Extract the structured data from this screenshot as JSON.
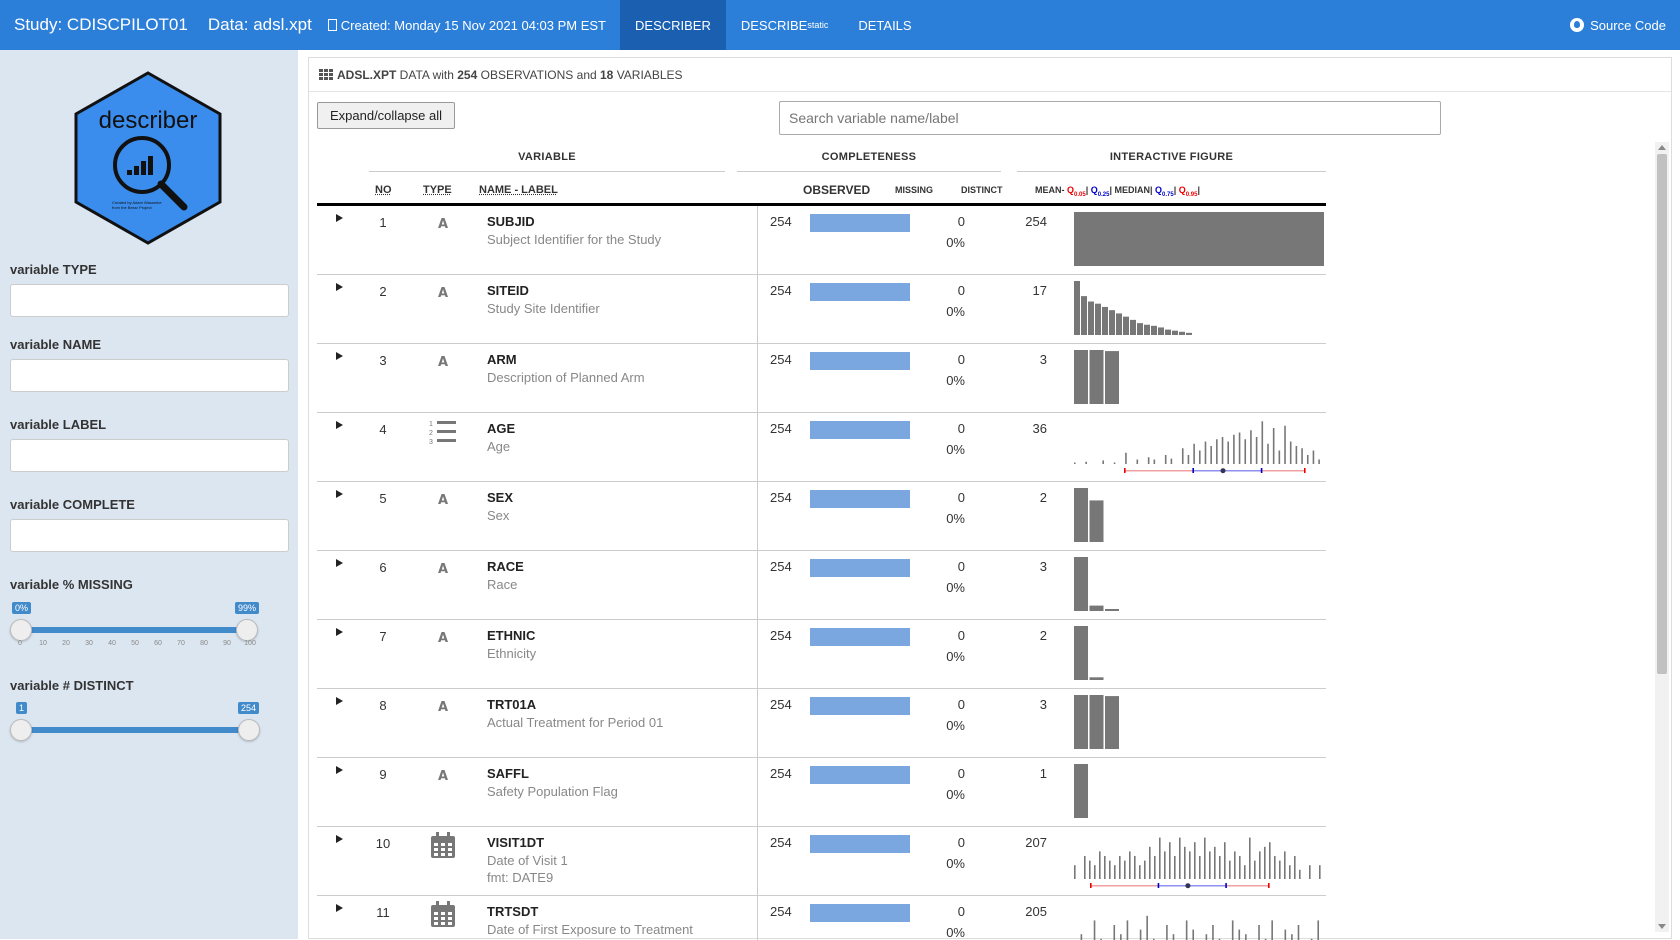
{
  "nav": {
    "study": "Study: CDISCPILOT01",
    "data": "Data: adsl.xpt",
    "created": "Created: Monday 15 Nov 2021 04:03 PM EST",
    "tabs": [
      {
        "label": "DESCRIBER",
        "sub": "",
        "active": true
      },
      {
        "label": "DESCRIBE",
        "sub": "static",
        "active": false
      },
      {
        "label": "DETAILS",
        "sub": "",
        "active": false
      }
    ],
    "source": "Source Code"
  },
  "sidebar": {
    "logo_text": "describer",
    "logo_credit_line1": "Created by Adam Wasserke",
    "logo_credit_line2": "from the Bessr Project",
    "filters": [
      {
        "label": "variable TYPE"
      },
      {
        "label": "variable NAME"
      },
      {
        "label": "variable LABEL"
      },
      {
        "label": "variable COMPLETE"
      }
    ],
    "missing_slider": {
      "label": "variable % MISSING",
      "low": "0%",
      "high": "99%",
      "ticks": [
        "0",
        "10",
        "20",
        "30",
        "40",
        "50",
        "60",
        "70",
        "80",
        "90",
        "100"
      ]
    },
    "distinct_slider": {
      "label": "variable # DISTINCT",
      "low": "1",
      "high": "254"
    }
  },
  "main": {
    "header_file": "ADSL.XPT",
    "header_mid1": " DATA with ",
    "header_obs": "254",
    "header_mid2": " OBSERVATIONS and ",
    "header_vars": "18",
    "header_end": " VARIABLES",
    "expand_label": "Expand/collapse all",
    "search_placeholder": "Search variable name/label",
    "groups": {
      "variable": "VARIABLE",
      "completeness": "COMPLETENESS",
      "figure": "INTERACTIVE FIGURE"
    },
    "columns": {
      "no": "NO",
      "type": "TYPE",
      "name": "NAME - LABEL",
      "observed": "OBSERVED",
      "missing": "MISSING",
      "distinct": "DISTINCT"
    },
    "legend": {
      "mean": "MEAN",
      "median": "MEDIAN",
      "q005": "Q",
      "q005s": "0.05",
      "q025": "Q",
      "q025s": "0.25",
      "q075": "Q",
      "q075s": "0.75",
      "q095": "Q",
      "q095s": "0.95"
    },
    "rows": [
      {
        "no": "1",
        "type": "A",
        "name": "SUBJID",
        "label": "Subject Identifier for the Study",
        "fmt": "",
        "observed": "254",
        "missing": "0",
        "missing_pct": "0%",
        "distinct": "254",
        "fig": "full",
        "bars": []
      },
      {
        "no": "2",
        "type": "A",
        "name": "SITEID",
        "label": "Study Site Identifier",
        "fmt": "",
        "observed": "254",
        "missing": "0",
        "missing_pct": "0%",
        "distinct": "17",
        "fig": "bars",
        "bars": [
          1.0,
          0.72,
          0.62,
          0.58,
          0.52,
          0.46,
          0.4,
          0.34,
          0.28,
          0.22,
          0.19,
          0.17,
          0.14,
          0.1,
          0.08,
          0.06,
          0.04
        ]
      },
      {
        "no": "3",
        "type": "A",
        "name": "ARM",
        "label": "Description of Planned Arm",
        "fmt": "",
        "observed": "254",
        "missing": "0",
        "missing_pct": "0%",
        "distinct": "3",
        "fig": "bars",
        "bars": [
          1.0,
          1.0,
          0.98
        ]
      },
      {
        "no": "4",
        "type": "num",
        "name": "AGE",
        "label": "Age",
        "fmt": "",
        "observed": "254",
        "missing": "0",
        "missing_pct": "0%",
        "distinct": "36",
        "fig": "spikes",
        "bars": [
          0.03,
          0,
          0.05,
          0,
          0,
          0.08,
          0,
          0.02,
          0,
          0.25,
          0,
          0.1,
          0,
          0.15,
          0.1,
          0,
          0.2,
          0.12,
          0,
          0.35,
          0.2,
          0.45,
          0.3,
          0.5,
          0.4,
          0.55,
          0.6,
          0.5,
          0.65,
          0.7,
          0.55,
          0.75,
          0.6,
          0.95,
          0.45,
          0.8,
          0.3,
          0.85,
          0.5,
          0.4,
          0.35,
          0.2,
          0.3,
          0.1
        ]
      },
      {
        "no": "5",
        "type": "A",
        "name": "SEX",
        "label": "Sex",
        "fmt": "",
        "observed": "254",
        "missing": "0",
        "missing_pct": "0%",
        "distinct": "2",
        "fig": "bars",
        "bars": [
          1.0,
          0.77
        ]
      },
      {
        "no": "6",
        "type": "A",
        "name": "RACE",
        "label": "Race",
        "fmt": "",
        "observed": "254",
        "missing": "0",
        "missing_pct": "0%",
        "distinct": "3",
        "fig": "bars",
        "bars": [
          1.0,
          0.1,
          0.02
        ]
      },
      {
        "no": "7",
        "type": "A",
        "name": "ETHNIC",
        "label": "Ethnicity",
        "fmt": "",
        "observed": "254",
        "missing": "0",
        "missing_pct": "0%",
        "distinct": "2",
        "fig": "bars",
        "bars": [
          1.0,
          0.05
        ]
      },
      {
        "no": "8",
        "type": "A",
        "name": "TRT01A",
        "label": "Actual Treatment for Period 01",
        "fmt": "",
        "observed": "254",
        "missing": "0",
        "missing_pct": "0%",
        "distinct": "3",
        "fig": "bars",
        "bars": [
          1.0,
          1.0,
          0.98
        ]
      },
      {
        "no": "9",
        "type": "A",
        "name": "SAFFL",
        "label": "Safety Population Flag",
        "fmt": "",
        "observed": "254",
        "missing": "0",
        "missing_pct": "0%",
        "distinct": "1",
        "fig": "bars",
        "bars": [
          1.0
        ]
      },
      {
        "no": "10",
        "type": "date",
        "name": "VISIT1DT",
        "label": "Date of Visit 1",
        "fmt": "fmt: DATE9",
        "observed": "254",
        "missing": "0",
        "missing_pct": "0%",
        "distinct": "207",
        "fig": "spikes2",
        "bars": [
          0.3,
          0,
          0.5,
          0.4,
          0.3,
          0.6,
          0.5,
          0.4,
          0.3,
          0.5,
          0.4,
          0.6,
          0.5,
          0.3,
          0.4,
          0.7,
          0.5,
          0.9,
          0.6,
          0.8,
          0.5,
          0.9,
          0.7,
          0.6,
          0.8,
          0.5,
          0.9,
          0.6,
          0.7,
          0.5,
          0.8,
          0.4,
          0.6,
          0.5,
          0.3,
          0.9,
          0.4,
          0.6,
          0.7,
          0.8,
          0.5,
          0.4,
          0.6,
          0.3,
          0.5,
          0.2,
          0,
          0.3,
          0,
          0.3
        ]
      },
      {
        "no": "11",
        "type": "date",
        "name": "TRTSDT",
        "label": "Date of First Exposure to Treatment",
        "fmt": "",
        "observed": "254",
        "missing": "0",
        "missing_pct": "0%",
        "distinct": "205",
        "fig": "spikes2",
        "bars": [
          0,
          0.3,
          0,
          0.6,
          0.2,
          0,
          0.5,
          0.3,
          0.6,
          0,
          0.4,
          0.7,
          0.2,
          0,
          0.5,
          0.3,
          0,
          0.6,
          0.4,
          0,
          0.3,
          0.5,
          0.2,
          0,
          0.6,
          0.4,
          0.3,
          0,
          0.5,
          0.2,
          0.6,
          0,
          0.4,
          0.3,
          0.5,
          0,
          0.2,
          0.6
        ]
      }
    ]
  }
}
